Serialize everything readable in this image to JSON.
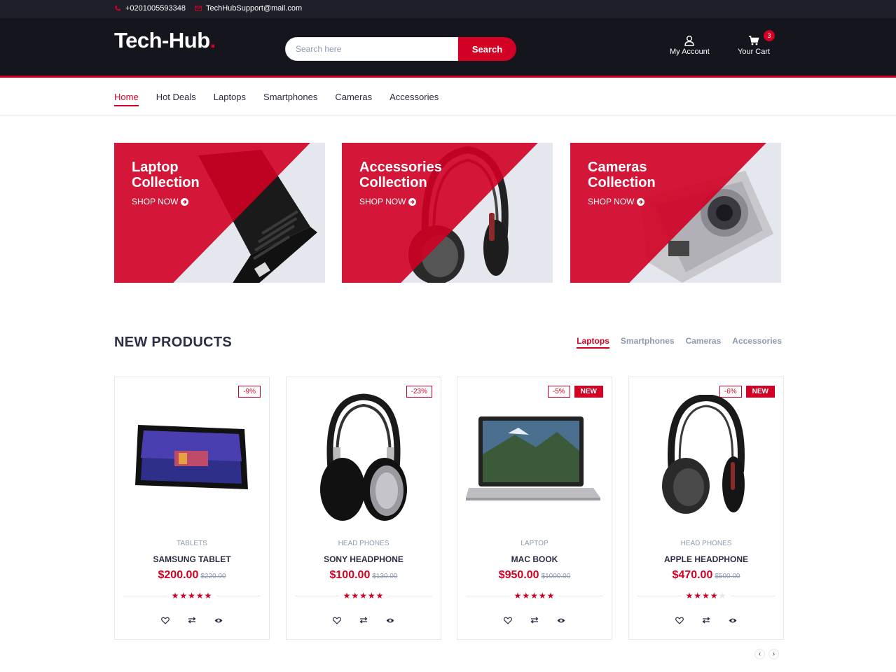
{
  "topbar": {
    "phone": "+0201005593348",
    "email": "TechHubSupport@mail.com"
  },
  "header": {
    "logo_text": "Tech-Hub",
    "logo_dot": ".",
    "search_placeholder": "Search here",
    "search_button": "Search",
    "account_label": "My Account",
    "cart_label": "Your Cart",
    "cart_count": "3"
  },
  "nav": {
    "items": [
      "Home",
      "Hot Deals",
      "Laptops",
      "Smartphones",
      "Cameras",
      "Accessories"
    ],
    "active": "Home"
  },
  "collections": [
    {
      "line1": "Laptop",
      "line2": "Collection",
      "cta": "SHOP NOW"
    },
    {
      "line1": "Accessories",
      "line2": "Collection",
      "cta": "SHOP NOW"
    },
    {
      "line1": "Cameras",
      "line2": "Collection",
      "cta": "SHOP NOW"
    }
  ],
  "section": {
    "title": "NEW PRODUCTS",
    "tabs": [
      "Laptops",
      "Smartphones",
      "Cameras",
      "Accessories"
    ],
    "active_tab": "Laptops"
  },
  "products": [
    {
      "sale": "-9%",
      "new": "",
      "category": "TABLETS",
      "name": "SAMSUNG TABLET",
      "price": "$200.00",
      "old_price": "$220.00",
      "rating": 5
    },
    {
      "sale": "-23%",
      "new": "",
      "category": "HEAD PHONES",
      "name": "SONY HEADPHONE",
      "price": "$100.00",
      "old_price": "$130.00",
      "rating": 5
    },
    {
      "sale": "-5%",
      "new": "NEW",
      "category": "LAPTOP",
      "name": "MAC BOOK",
      "price": "$950.00",
      "old_price": "$1000.00",
      "rating": 5
    },
    {
      "sale": "-6%",
      "new": "NEW",
      "category": "HEAD PHONES",
      "name": "APPLE HEADPHONE",
      "price": "$470.00",
      "old_price": "$500.00",
      "rating": 4
    }
  ],
  "colors": {
    "accent": "#d10024",
    "dark": "#15161d",
    "topbar": "#1e1f29",
    "text": "#2b2d42",
    "muted": "#8d99ae"
  },
  "icons": [
    "phone-icon",
    "mail-icon",
    "user-icon",
    "cart-icon",
    "arrow-circle-right-icon",
    "heart-icon",
    "exchange-icon",
    "eye-icon",
    "chevron-left-icon",
    "chevron-right-icon"
  ]
}
